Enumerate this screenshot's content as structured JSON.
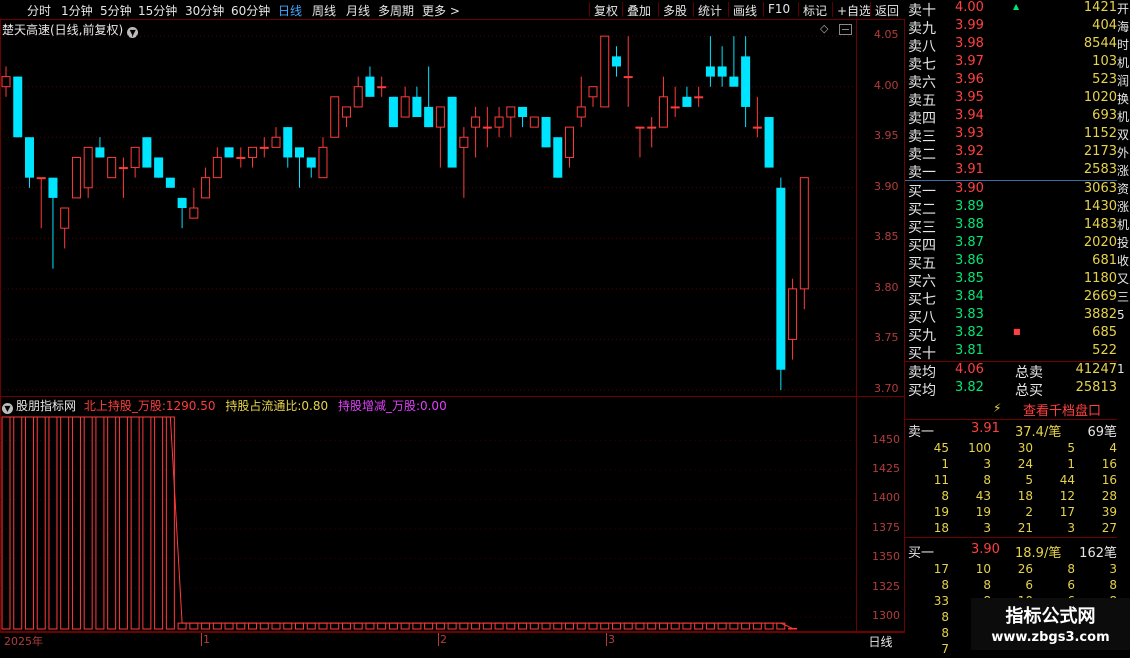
{
  "toolbar": {
    "left_items": [
      "分时",
      "1分钟",
      "5分钟",
      "15分钟",
      "30分钟",
      "60分钟",
      "日线",
      "周线",
      "月线",
      "多周期",
      "更多 >"
    ],
    "active_item": "日线",
    "right_items": [
      "复权",
      "叠加",
      "多股",
      "统计",
      "画线",
      "F10",
      "标记",
      "+自选",
      "返回"
    ]
  },
  "kline_title": "楚天高速(日线,前复权)",
  "kline_title_icon": "chevron-down-icon",
  "kline_corner_icons": [
    "diamond-icon",
    "minimize-icon"
  ],
  "price_axis": [
    "4.05",
    "4.00",
    "3.95",
    "3.90",
    "3.85",
    "3.80",
    "3.75",
    "3.70"
  ],
  "indicator": {
    "name": "股朋指标网",
    "v1_label": "北上持股_万股:",
    "v1_value": "1290.50",
    "v2_label": "持股占流通比:",
    "v2_value": "0.80",
    "v3_label": "持股增减_万股:",
    "v3_value": "0.00",
    "axis": [
      "1450",
      "1425",
      "1400",
      "1375",
      "1350",
      "1325",
      "1300"
    ],
    "colors": {
      "v1": "#ff3b3b",
      "v2": "#e6d34a",
      "v3": "#e040fb"
    }
  },
  "date_axis": {
    "year": "2025年",
    "months": [
      "1",
      "2",
      "3"
    ],
    "period_label": "日线"
  },
  "orderbook": {
    "asks": [
      {
        "label": "卖十",
        "price": "4.00",
        "vol": "1421",
        "mark": "▲"
      },
      {
        "label": "卖九",
        "price": "3.99",
        "vol": "404"
      },
      {
        "label": "卖八",
        "price": "3.98",
        "vol": "8544"
      },
      {
        "label": "卖七",
        "price": "3.97",
        "vol": "103"
      },
      {
        "label": "卖六",
        "price": "3.96",
        "vol": "523"
      },
      {
        "label": "卖五",
        "price": "3.95",
        "vol": "1020"
      },
      {
        "label": "卖四",
        "price": "3.94",
        "vol": "693"
      },
      {
        "label": "卖三",
        "price": "3.93",
        "vol": "1152"
      },
      {
        "label": "卖二",
        "price": "3.92",
        "vol": "2173"
      },
      {
        "label": "卖一",
        "price": "3.91",
        "vol": "2583"
      }
    ],
    "bids": [
      {
        "label": "买一",
        "price": "3.90",
        "vol": "3063"
      },
      {
        "label": "买二",
        "price": "3.89",
        "vol": "1430"
      },
      {
        "label": "买三",
        "price": "3.88",
        "vol": "1483"
      },
      {
        "label": "买四",
        "price": "3.87",
        "vol": "2020"
      },
      {
        "label": "买五",
        "price": "3.86",
        "vol": "681"
      },
      {
        "label": "买六",
        "price": "3.85",
        "vol": "1180"
      },
      {
        "label": "买七",
        "price": "3.84",
        "vol": "2669"
      },
      {
        "label": "买八",
        "price": "3.83",
        "vol": "3882"
      },
      {
        "label": "买九",
        "price": "3.82",
        "vol": "685",
        "mark": "■"
      },
      {
        "label": "买十",
        "price": "3.81",
        "vol": "522"
      }
    ],
    "avg_sell_label": "卖均",
    "avg_sell": "4.06",
    "total_sell_label": "总卖",
    "total_sell": "41247",
    "avg_buy_label": "买均",
    "avg_buy": "3.82",
    "total_buy_label": "总买",
    "total_buy": "25813",
    "colors": {
      "up": "#ff4040",
      "down": "#00e676",
      "vol": "#e6d34a"
    }
  },
  "right_strip": [
    "开",
    "海",
    "时",
    "机",
    "润",
    "换",
    "机",
    "双",
    "外",
    "涨",
    "资",
    "涨",
    "机",
    "投",
    "收",
    "又",
    "三",
    "5",
    "",
    "",
    "1"
  ],
  "thousand": {
    "button": "查看千档盘口",
    "ask1_label": "卖一",
    "ask1_price": "3.91",
    "ask1_avg": "37.4/笔",
    "ask1_count": "69笔",
    "ask1_grid": [
      [
        "45",
        "100",
        "30",
        "5",
        "4"
      ],
      [
        "1",
        "3",
        "24",
        "1",
        "16"
      ],
      [
        "11",
        "8",
        "5",
        "44",
        "16"
      ],
      [
        "8",
        "43",
        "18",
        "12",
        "28"
      ],
      [
        "19",
        "19",
        "2",
        "17",
        "39"
      ],
      [
        "18",
        "3",
        "21",
        "3",
        "27"
      ]
    ],
    "bid1_label": "买一",
    "bid1_price": "3.90",
    "bid1_avg": "18.9/笔",
    "bid1_count": "162笔",
    "bid1_grid": [
      [
        "17",
        "10",
        "26",
        "8",
        "3"
      ],
      [
        "8",
        "8",
        "6",
        "6",
        "8"
      ],
      [
        "33",
        "8",
        "10",
        "6",
        "8"
      ],
      [
        "8",
        "",
        "",
        "",
        ""
      ],
      [
        "8",
        "",
        "",
        "",
        ""
      ],
      [
        "7",
        "",
        "",
        "",
        ""
      ]
    ]
  },
  "watermark": {
    "line1": "指标公式网",
    "line2": "www.zbgs3.com"
  },
  "chart_data": {
    "type": "candlestick",
    "y_range": [
      3.695,
      4.065
    ],
    "up_color": "#ff3b3b",
    "down_color": "#00e5ff",
    "candles": [
      {
        "o": 4.0,
        "h": 4.02,
        "l": 3.99,
        "c": 4.01
      },
      {
        "o": 4.01,
        "h": 4.01,
        "l": 3.95,
        "c": 3.95
      },
      {
        "o": 3.95,
        "h": 3.95,
        "l": 3.9,
        "c": 3.91
      },
      {
        "o": 3.91,
        "h": 3.91,
        "l": 3.86,
        "c": 3.91
      },
      {
        "o": 3.91,
        "h": 3.91,
        "l": 3.82,
        "c": 3.89
      },
      {
        "o": 3.86,
        "h": 3.88,
        "l": 3.84,
        "c": 3.88
      },
      {
        "o": 3.89,
        "h": 3.93,
        "l": 3.89,
        "c": 3.93
      },
      {
        "o": 3.9,
        "h": 3.94,
        "l": 3.89,
        "c": 3.94
      },
      {
        "o": 3.94,
        "h": 3.95,
        "l": 3.93,
        "c": 3.93
      },
      {
        "o": 3.91,
        "h": 3.93,
        "l": 3.91,
        "c": 3.93
      },
      {
        "o": 3.92,
        "h": 3.93,
        "l": 3.89,
        "c": 3.92
      },
      {
        "o": 3.92,
        "h": 3.94,
        "l": 3.91,
        "c": 3.94
      },
      {
        "o": 3.95,
        "h": 3.95,
        "l": 3.92,
        "c": 3.92
      },
      {
        "o": 3.93,
        "h": 3.93,
        "l": 3.91,
        "c": 3.91
      },
      {
        "o": 3.91,
        "h": 3.91,
        "l": 3.9,
        "c": 3.9
      },
      {
        "o": 3.89,
        "h": 3.89,
        "l": 3.86,
        "c": 3.88
      },
      {
        "o": 3.87,
        "h": 3.9,
        "l": 3.87,
        "c": 3.88
      },
      {
        "o": 3.89,
        "h": 3.92,
        "l": 3.89,
        "c": 3.91
      },
      {
        "o": 3.91,
        "h": 3.94,
        "l": 3.91,
        "c": 3.93
      },
      {
        "o": 3.94,
        "h": 3.94,
        "l": 3.93,
        "c": 3.93
      },
      {
        "o": 3.93,
        "h": 3.94,
        "l": 3.92,
        "c": 3.93
      },
      {
        "o": 3.93,
        "h": 3.94,
        "l": 3.92,
        "c": 3.94
      },
      {
        "o": 3.94,
        "h": 3.95,
        "l": 3.93,
        "c": 3.94
      },
      {
        "o": 3.94,
        "h": 3.96,
        "l": 3.94,
        "c": 3.95
      },
      {
        "o": 3.96,
        "h": 3.96,
        "l": 3.92,
        "c": 3.93
      },
      {
        "o": 3.94,
        "h": 3.94,
        "l": 3.9,
        "c": 3.93
      },
      {
        "o": 3.93,
        "h": 3.93,
        "l": 3.91,
        "c": 3.92
      },
      {
        "o": 3.91,
        "h": 3.95,
        "l": 3.91,
        "c": 3.94
      },
      {
        "o": 3.95,
        "h": 3.99,
        "l": 3.95,
        "c": 3.99
      },
      {
        "o": 3.97,
        "h": 3.98,
        "l": 3.96,
        "c": 3.98
      },
      {
        "o": 3.98,
        "h": 4.01,
        "l": 3.98,
        "c": 4.0
      },
      {
        "o": 4.01,
        "h": 4.02,
        "l": 3.99,
        "c": 3.99
      },
      {
        "o": 4.0,
        "h": 4.01,
        "l": 3.99,
        "c": 4.0
      },
      {
        "o": 3.99,
        "h": 3.99,
        "l": 3.96,
        "c": 3.96
      },
      {
        "o": 3.97,
        "h": 4.0,
        "l": 3.97,
        "c": 3.99
      },
      {
        "o": 3.99,
        "h": 4.0,
        "l": 3.97,
        "c": 3.97
      },
      {
        "o": 3.98,
        "h": 4.02,
        "l": 3.96,
        "c": 3.96
      },
      {
        "o": 3.96,
        "h": 3.98,
        "l": 3.92,
        "c": 3.98
      },
      {
        "o": 3.99,
        "h": 3.99,
        "l": 3.92,
        "c": 3.92
      },
      {
        "o": 3.94,
        "h": 3.96,
        "l": 3.89,
        "c": 3.95
      },
      {
        "o": 3.96,
        "h": 3.98,
        "l": 3.93,
        "c": 3.97
      },
      {
        "o": 3.96,
        "h": 3.98,
        "l": 3.94,
        "c": 3.96
      },
      {
        "o": 3.96,
        "h": 3.98,
        "l": 3.95,
        "c": 3.97
      },
      {
        "o": 3.97,
        "h": 3.98,
        "l": 3.95,
        "c": 3.98
      },
      {
        "o": 3.98,
        "h": 3.98,
        "l": 3.96,
        "c": 3.97
      },
      {
        "o": 3.96,
        "h": 3.97,
        "l": 3.96,
        "c": 3.97
      },
      {
        "o": 3.97,
        "h": 3.97,
        "l": 3.94,
        "c": 3.94
      },
      {
        "o": 3.95,
        "h": 3.95,
        "l": 3.91,
        "c": 3.91
      },
      {
        "o": 3.93,
        "h": 3.96,
        "l": 3.92,
        "c": 3.96
      },
      {
        "o": 3.97,
        "h": 4.01,
        "l": 3.96,
        "c": 3.98
      },
      {
        "o": 3.99,
        "h": 4.0,
        "l": 3.98,
        "c": 4.0
      },
      {
        "o": 3.98,
        "h": 4.05,
        "l": 3.98,
        "c": 4.05
      },
      {
        "o": 4.03,
        "h": 4.04,
        "l": 4.01,
        "c": 4.02
      },
      {
        "o": 4.01,
        "h": 4.05,
        "l": 3.98,
        "c": 4.01
      },
      {
        "o": 3.96,
        "h": 3.96,
        "l": 3.93,
        "c": 3.96
      },
      {
        "o": 3.96,
        "h": 3.97,
        "l": 3.94,
        "c": 3.96
      },
      {
        "o": 3.96,
        "h": 4.01,
        "l": 3.96,
        "c": 3.99
      },
      {
        "o": 3.98,
        "h": 4.0,
        "l": 3.97,
        "c": 3.98
      },
      {
        "o": 3.99,
        "h": 4.0,
        "l": 3.98,
        "c": 3.98
      },
      {
        "o": 3.99,
        "h": 4.0,
        "l": 3.98,
        "c": 3.99
      },
      {
        "o": 4.02,
        "h": 4.05,
        "l": 4.0,
        "c": 4.01
      },
      {
        "o": 4.02,
        "h": 4.04,
        "l": 4.0,
        "c": 4.01
      },
      {
        "o": 4.01,
        "h": 4.05,
        "l": 4.0,
        "c": 4.0
      },
      {
        "o": 4.03,
        "h": 4.05,
        "l": 3.96,
        "c": 3.98
      },
      {
        "o": 3.96,
        "h": 3.99,
        "l": 3.95,
        "c": 3.96
      },
      {
        "o": 3.97,
        "h": 3.97,
        "l": 3.92,
        "c": 3.92
      },
      {
        "o": 3.9,
        "h": 3.91,
        "l": 3.7,
        "c": 3.72
      },
      {
        "o": 3.75,
        "h": 3.81,
        "l": 3.73,
        "c": 3.8
      },
      {
        "o": 3.8,
        "h": 3.91,
        "l": 3.78,
        "c": 3.91
      }
    ],
    "holdings": {
      "y_range": [
        1290,
        1470
      ],
      "values": [
        1470,
        1470,
        1470,
        1470,
        1470,
        1470,
        1470,
        1470,
        1470,
        1470,
        1470,
        1470,
        1470,
        1470,
        1470,
        1295,
        1295,
        1295,
        1295,
        1295,
        1295,
        1295,
        1295,
        1295,
        1295,
        1295,
        1295,
        1295,
        1295,
        1295,
        1295,
        1295,
        1295,
        1295,
        1295,
        1295,
        1295,
        1295,
        1295,
        1295,
        1295,
        1295,
        1295,
        1295,
        1295,
        1295,
        1295,
        1295,
        1295,
        1295,
        1295,
        1295,
        1295,
        1295,
        1295,
        1295,
        1295,
        1295,
        1295,
        1295,
        1295,
        1295,
        1295,
        1295,
        1295,
        1295,
        1295,
        1290.5
      ]
    }
  }
}
